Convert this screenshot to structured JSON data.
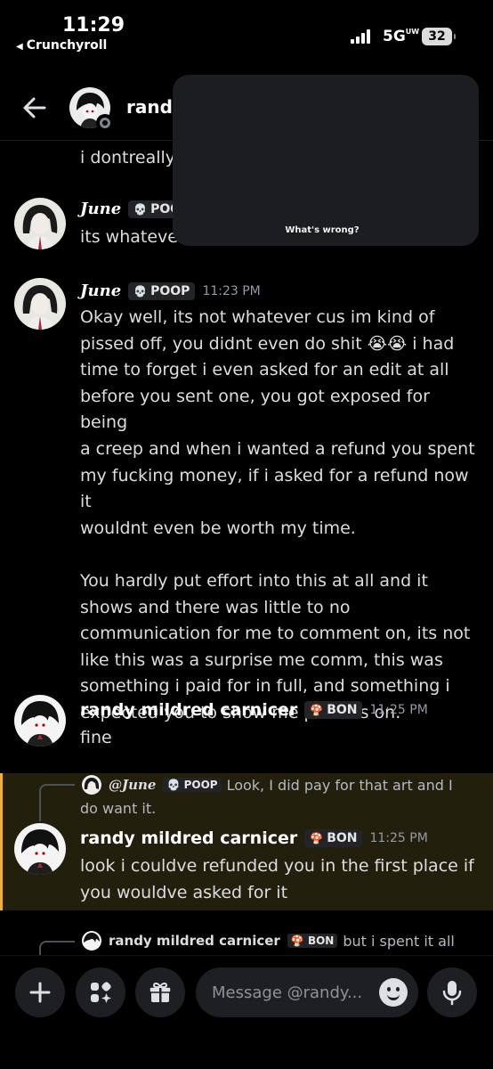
{
  "status_bar": {
    "time": "11:29",
    "back_app": "Crunchyroll",
    "network": "5G",
    "network_sup": "UW",
    "battery": "32"
  },
  "header": {
    "name": "randy",
    "back_icon": "arrow-left-icon"
  },
  "overlay": {
    "label": "What's wrong?"
  },
  "messages": [
    {
      "type": "continuation",
      "text": "i dontreally"
    },
    {
      "author": "June",
      "tag": "POOP",
      "tag_icon": "skull-icon",
      "timestamp": "",
      "text": "its whatever"
    },
    {
      "author": "June",
      "tag": "POOP",
      "tag_icon": "skull-icon",
      "timestamp": "11:23 PM",
      "paragraph1_lines": [
        "Okay well, its not whatever cus im kind of",
        "pissed off, you didnt even do shit",
        "time to forget i even asked for an edit at all",
        "before you sent one, you got exposed for being",
        "a creep and when i wanted a refund you spent",
        "my fucking money, if i asked for a refund now it",
        "wouldnt even be worth my time."
      ],
      "line2_tail": "i had",
      "emoji": "😭😭",
      "paragraph2_lines": [
        "You hardly put effort into this at all and it",
        "shows and there was little to no",
        "communication for me to comment on, its not",
        "like this was a surprise me comm, this was",
        "something i paid for in full, and something i",
        "expected you to show me process on."
      ]
    },
    {
      "author": "randy mildred carnicer",
      "tag": "BON",
      "tag_icon": "mushroom-icon",
      "timestamp": "11:25 PM",
      "text": "fine"
    },
    {
      "author": "randy mildred carnicer",
      "tag": "BON",
      "timestamp": "11:25 PM",
      "reply_to": {
        "author": "@June",
        "tag": "POOP",
        "text_line1": "Look, I did pay for that art and I",
        "text_line2": "do want it."
      },
      "lines": [
        "look i couldve refunded you in the first place if",
        "you wouldve asked for it"
      ]
    },
    {
      "reply_preview": {
        "author": "randy mildred carnicer",
        "tag": "BON",
        "text": "but i spent it all"
      }
    }
  ],
  "composer": {
    "placeholder": "Message @randy...",
    "buttons": [
      "plus-icon",
      "apps-icon",
      "gift-icon",
      "mic-icon"
    ]
  },
  "colors": {
    "background": "#000000",
    "reply_highlight": "#221f0d",
    "reply_bar": "#f0b232",
    "timestamp": "#949ba4"
  }
}
